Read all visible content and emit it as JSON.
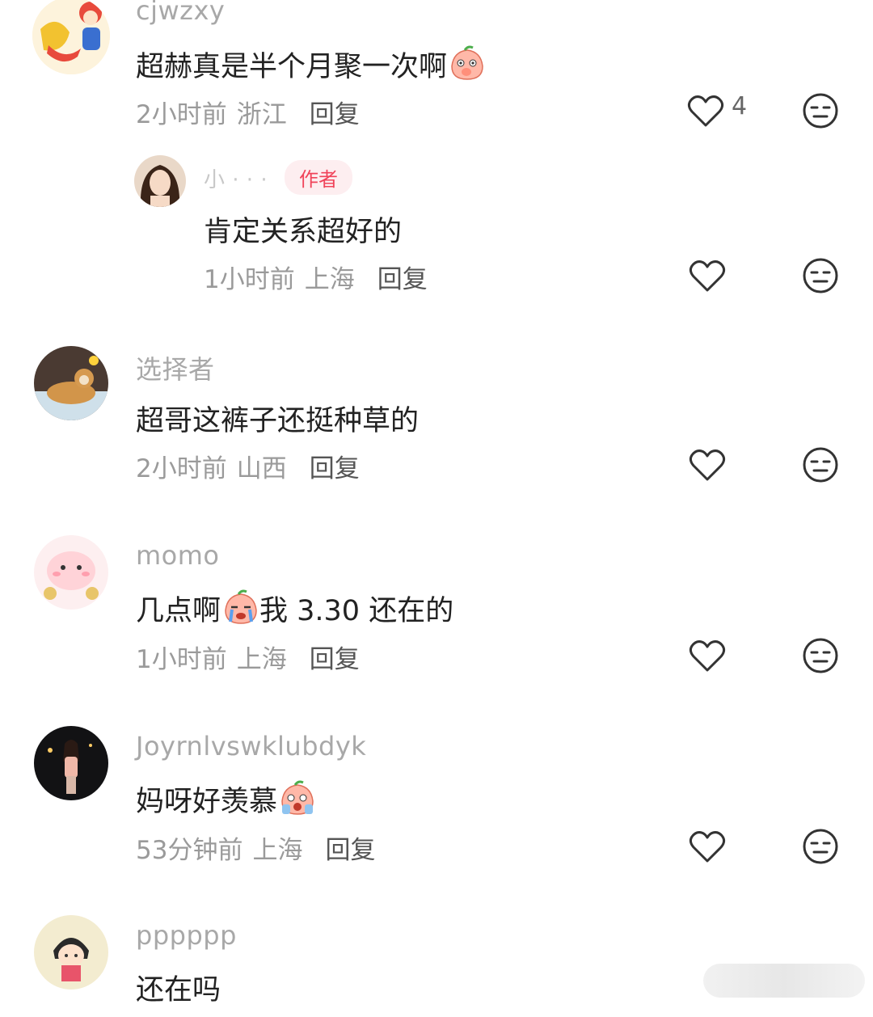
{
  "comments": [
    {
      "username": "cjwzxy",
      "text": "超赫真是半个月聚一次啊",
      "emoji": "blushing-peach-emoji",
      "time": "2小时前",
      "location": "浙江",
      "reply_label": "回复",
      "likes": "4",
      "reply": {
        "username": "小 · · ·",
        "author_tag": "作者",
        "text": "肯定关系超好的",
        "time": "1小时前",
        "location": "上海",
        "reply_label": "回复"
      }
    },
    {
      "username": "选择者",
      "text": "超哥这裤子还挺种草的",
      "time": "2小时前",
      "location": "山西",
      "reply_label": "回复"
    },
    {
      "username": "momo",
      "text_before": "几点啊",
      "emoji": "crying-peach-emoji",
      "text_after": "我 3.30 还在的",
      "time": "1小时前",
      "location": "上海",
      "reply_label": "回复"
    },
    {
      "username": "Joyrnlvswklubdyk",
      "text": "妈呀好羡慕",
      "emoji": "shocked-peach-emoji",
      "time": "53分钟前",
      "location": "上海",
      "reply_label": "回复"
    },
    {
      "username": "pppppp",
      "text": "还在吗"
    }
  ],
  "colors": {
    "author_tag": "#f0445a",
    "username": "#a8a8a8",
    "text": "#222222",
    "meta": "#9a9a9a"
  },
  "icons": [
    "heart-outline-icon",
    "meh-face-icon"
  ]
}
